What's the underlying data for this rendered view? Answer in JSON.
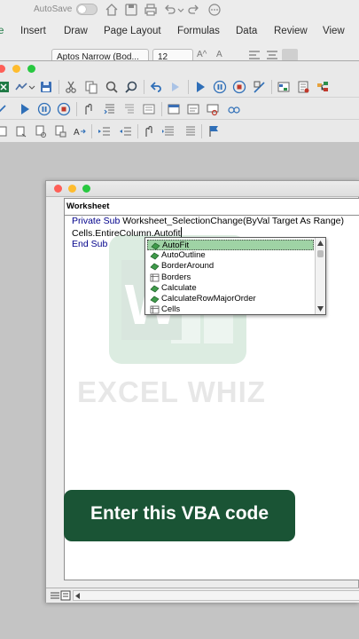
{
  "excel": {
    "autosave_label": "AutoSave",
    "tabs": [
      "e",
      "Insert",
      "Draw",
      "Page Layout",
      "Formulas",
      "Data",
      "Review",
      "View"
    ],
    "font_name": "Aptos Narrow (Bod...",
    "font_size": "12",
    "font_grow": "A^",
    "font_shrink": "A"
  },
  "code_window": {
    "object_dropdown": "Worksheet",
    "lines": [
      {
        "keyword": "Private Sub ",
        "rest": "Worksheet_SelectionChange(ByVal Target As Range)"
      },
      {
        "keyword": "",
        "rest": "Cells.EntireColumn.Autofit"
      },
      {
        "keyword": "End Sub",
        "rest": ""
      }
    ]
  },
  "intellisense": {
    "items": [
      {
        "label": "AutoFit",
        "icon": "method-icon",
        "selected": true
      },
      {
        "label": "AutoOutline",
        "icon": "method-icon",
        "selected": false
      },
      {
        "label": "BorderAround",
        "icon": "method-icon",
        "selected": false
      },
      {
        "label": "Borders",
        "icon": "property-icon",
        "selected": false
      },
      {
        "label": "Calculate",
        "icon": "method-icon",
        "selected": false
      },
      {
        "label": "CalculateRowMajorOrder",
        "icon": "method-icon",
        "selected": false
      },
      {
        "label": "Cells",
        "icon": "property-icon",
        "selected": false
      }
    ]
  },
  "watermark": {
    "text": "EXCEL WHIZ",
    "logo_letter": "W"
  },
  "caption": {
    "text": "Enter this VBA code"
  },
  "colors": {
    "excel_green": "#1f7a45",
    "banner": "#1a5435",
    "keyword": "#00008b",
    "selection": "#9fd3a5"
  }
}
